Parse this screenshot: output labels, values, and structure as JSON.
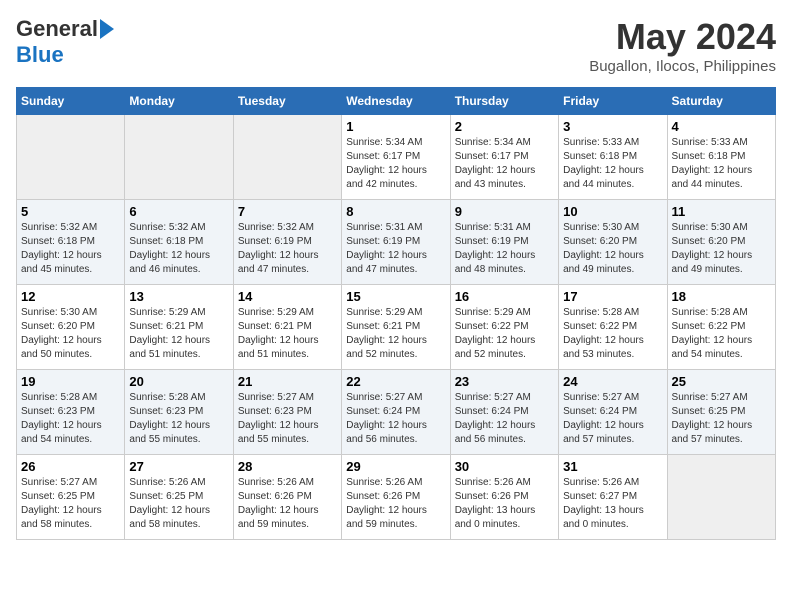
{
  "header": {
    "logo_general": "General",
    "logo_blue": "Blue",
    "title": "May 2024",
    "location": "Bugallon, Ilocos, Philippines"
  },
  "weekdays": [
    "Sunday",
    "Monday",
    "Tuesday",
    "Wednesday",
    "Thursday",
    "Friday",
    "Saturday"
  ],
  "weeks": [
    [
      {
        "day": "",
        "info": ""
      },
      {
        "day": "",
        "info": ""
      },
      {
        "day": "",
        "info": ""
      },
      {
        "day": "1",
        "info": "Sunrise: 5:34 AM\nSunset: 6:17 PM\nDaylight: 12 hours\nand 42 minutes."
      },
      {
        "day": "2",
        "info": "Sunrise: 5:34 AM\nSunset: 6:17 PM\nDaylight: 12 hours\nand 43 minutes."
      },
      {
        "day": "3",
        "info": "Sunrise: 5:33 AM\nSunset: 6:18 PM\nDaylight: 12 hours\nand 44 minutes."
      },
      {
        "day": "4",
        "info": "Sunrise: 5:33 AM\nSunset: 6:18 PM\nDaylight: 12 hours\nand 44 minutes."
      }
    ],
    [
      {
        "day": "5",
        "info": "Sunrise: 5:32 AM\nSunset: 6:18 PM\nDaylight: 12 hours\nand 45 minutes."
      },
      {
        "day": "6",
        "info": "Sunrise: 5:32 AM\nSunset: 6:18 PM\nDaylight: 12 hours\nand 46 minutes."
      },
      {
        "day": "7",
        "info": "Sunrise: 5:32 AM\nSunset: 6:19 PM\nDaylight: 12 hours\nand 47 minutes."
      },
      {
        "day": "8",
        "info": "Sunrise: 5:31 AM\nSunset: 6:19 PM\nDaylight: 12 hours\nand 47 minutes."
      },
      {
        "day": "9",
        "info": "Sunrise: 5:31 AM\nSunset: 6:19 PM\nDaylight: 12 hours\nand 48 minutes."
      },
      {
        "day": "10",
        "info": "Sunrise: 5:30 AM\nSunset: 6:20 PM\nDaylight: 12 hours\nand 49 minutes."
      },
      {
        "day": "11",
        "info": "Sunrise: 5:30 AM\nSunset: 6:20 PM\nDaylight: 12 hours\nand 49 minutes."
      }
    ],
    [
      {
        "day": "12",
        "info": "Sunrise: 5:30 AM\nSunset: 6:20 PM\nDaylight: 12 hours\nand 50 minutes."
      },
      {
        "day": "13",
        "info": "Sunrise: 5:29 AM\nSunset: 6:21 PM\nDaylight: 12 hours\nand 51 minutes."
      },
      {
        "day": "14",
        "info": "Sunrise: 5:29 AM\nSunset: 6:21 PM\nDaylight: 12 hours\nand 51 minutes."
      },
      {
        "day": "15",
        "info": "Sunrise: 5:29 AM\nSunset: 6:21 PM\nDaylight: 12 hours\nand 52 minutes."
      },
      {
        "day": "16",
        "info": "Sunrise: 5:29 AM\nSunset: 6:22 PM\nDaylight: 12 hours\nand 52 minutes."
      },
      {
        "day": "17",
        "info": "Sunrise: 5:28 AM\nSunset: 6:22 PM\nDaylight: 12 hours\nand 53 minutes."
      },
      {
        "day": "18",
        "info": "Sunrise: 5:28 AM\nSunset: 6:22 PM\nDaylight: 12 hours\nand 54 minutes."
      }
    ],
    [
      {
        "day": "19",
        "info": "Sunrise: 5:28 AM\nSunset: 6:23 PM\nDaylight: 12 hours\nand 54 minutes."
      },
      {
        "day": "20",
        "info": "Sunrise: 5:28 AM\nSunset: 6:23 PM\nDaylight: 12 hours\nand 55 minutes."
      },
      {
        "day": "21",
        "info": "Sunrise: 5:27 AM\nSunset: 6:23 PM\nDaylight: 12 hours\nand 55 minutes."
      },
      {
        "day": "22",
        "info": "Sunrise: 5:27 AM\nSunset: 6:24 PM\nDaylight: 12 hours\nand 56 minutes."
      },
      {
        "day": "23",
        "info": "Sunrise: 5:27 AM\nSunset: 6:24 PM\nDaylight: 12 hours\nand 56 minutes."
      },
      {
        "day": "24",
        "info": "Sunrise: 5:27 AM\nSunset: 6:24 PM\nDaylight: 12 hours\nand 57 minutes."
      },
      {
        "day": "25",
        "info": "Sunrise: 5:27 AM\nSunset: 6:25 PM\nDaylight: 12 hours\nand 57 minutes."
      }
    ],
    [
      {
        "day": "26",
        "info": "Sunrise: 5:27 AM\nSunset: 6:25 PM\nDaylight: 12 hours\nand 58 minutes."
      },
      {
        "day": "27",
        "info": "Sunrise: 5:26 AM\nSunset: 6:25 PM\nDaylight: 12 hours\nand 58 minutes."
      },
      {
        "day": "28",
        "info": "Sunrise: 5:26 AM\nSunset: 6:26 PM\nDaylight: 12 hours\nand 59 minutes."
      },
      {
        "day": "29",
        "info": "Sunrise: 5:26 AM\nSunset: 6:26 PM\nDaylight: 12 hours\nand 59 minutes."
      },
      {
        "day": "30",
        "info": "Sunrise: 5:26 AM\nSunset: 6:26 PM\nDaylight: 13 hours\nand 0 minutes."
      },
      {
        "day": "31",
        "info": "Sunrise: 5:26 AM\nSunset: 6:27 PM\nDaylight: 13 hours\nand 0 minutes."
      },
      {
        "day": "",
        "info": ""
      }
    ]
  ]
}
